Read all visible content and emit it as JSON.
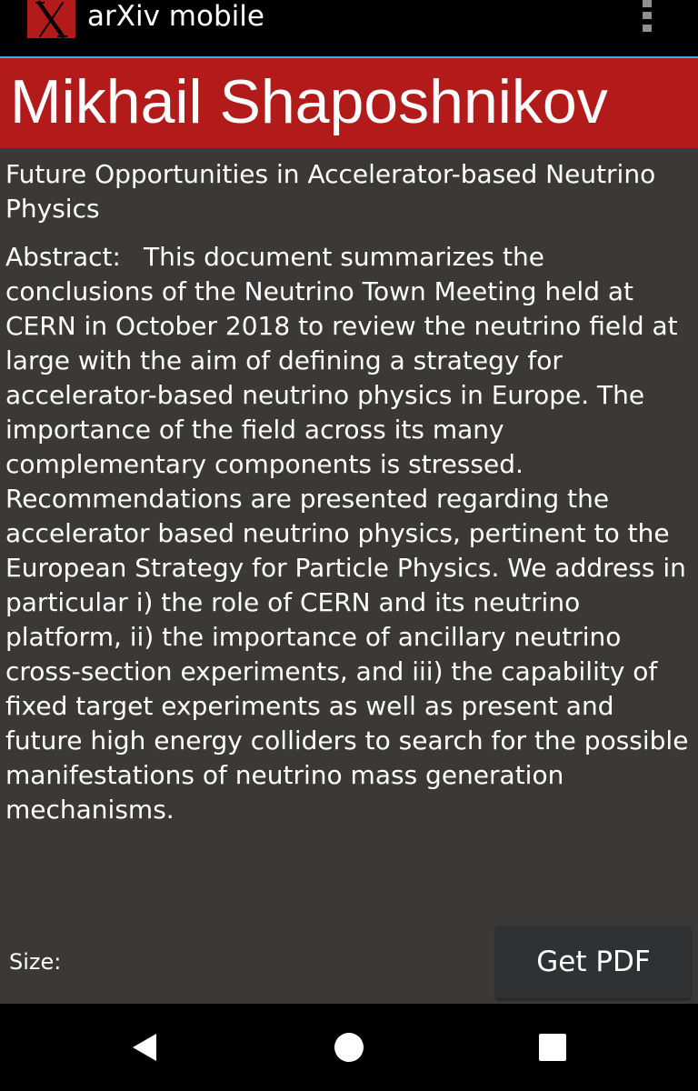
{
  "app_bar": {
    "title": "arXiv mobile",
    "logo_icon": "arxiv-x-logo-icon",
    "menu_icon": "overflow-menu-icon"
  },
  "author": {
    "name": "Mikhail Shaposhnikov"
  },
  "paper": {
    "title": "Future Opportunities in Accelerator-based Neutrino Physics",
    "abstract_label": "Abstract:",
    "abstract_text": "This document summarizes the conclusions of the Neutrino Town Meeting held at CERN in October 2018 to review the neutrino field at large with the aim of defining a strategy for accelerator-based neutrino physics in Europe. The importance of the field across its many complementary components is stressed. Recommendations are presented regarding the accelerator based neutrino physics, pertinent to the European Strategy for Particle Physics. We address in particular i) the role of CERN and its neutrino platform, ii) the importance of ancillary neutrino cross-section experiments, and iii) the capability of fixed target experiments as well as present and future high energy colliders to search for the possible manifestations of neutrino mass generation mechanisms."
  },
  "footer": {
    "size_label": "Size:",
    "get_pdf_label": "Get PDF"
  },
  "nav_bar": {
    "back_icon": "back-triangle-icon",
    "home_icon": "home-circle-icon",
    "recents_icon": "recents-square-icon"
  },
  "colors": {
    "brand_red": "#b31b1b",
    "accent_blue": "#33b5e5",
    "content_background": "#3a3938",
    "bar_background": "#000000",
    "button_background": "#2f3133"
  }
}
